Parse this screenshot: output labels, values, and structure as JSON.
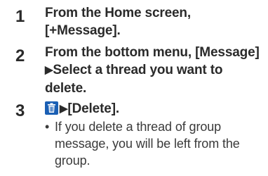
{
  "steps": [
    {
      "number": "1",
      "lines": [
        "From the Home screen,",
        "[+Message]."
      ]
    },
    {
      "number": "2",
      "lines": [
        "From the bottom menu, [Message]",
        "Select a thread you want to",
        "delete."
      ]
    },
    {
      "number": "3",
      "icon": "trash-icon",
      "text": "[Delete].",
      "note_bullet": "•",
      "note_lines": [
        "If you delete a thread of group",
        "message, you will be left from the",
        "group."
      ]
    }
  ],
  "arrow_glyph": "▶",
  "colors": {
    "text": "#2a2a2a",
    "icon_bg": "#1a5fb4"
  }
}
